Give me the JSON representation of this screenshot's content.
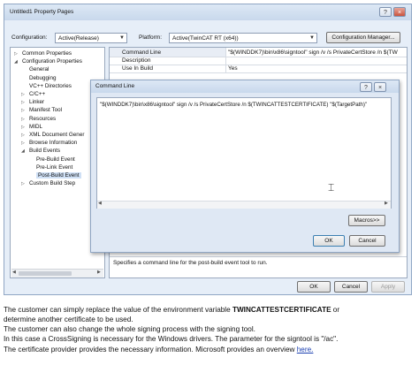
{
  "window": {
    "title": "Untitled1 Property Pages",
    "help_glyph": "?",
    "close_glyph": "×",
    "configuration_label": "Configuration:",
    "configuration_value": "Active(Release)",
    "platform_label": "Platform:",
    "platform_value": "Active(TwinCAT RT (x64))",
    "config_manager_label": "Configuration Manager...",
    "ok_label": "OK",
    "cancel_label": "Cancel",
    "apply_label": "Apply"
  },
  "tree": {
    "items": [
      {
        "label": "Common Properties",
        "expander": "▷"
      },
      {
        "label": "Configuration Properties",
        "expander": "◢"
      },
      {
        "label": "General",
        "expander": ""
      },
      {
        "label": "Debugging",
        "expander": ""
      },
      {
        "label": "VC++ Directories",
        "expander": ""
      },
      {
        "label": "C/C++",
        "expander": "▷"
      },
      {
        "label": "Linker",
        "expander": "▷"
      },
      {
        "label": "Manifest Tool",
        "expander": "▷"
      },
      {
        "label": "Resources",
        "expander": "▷"
      },
      {
        "label": "MIDL",
        "expander": "▷"
      },
      {
        "label": "XML Document Gener",
        "expander": "▷"
      },
      {
        "label": "Browse Information",
        "expander": "▷"
      },
      {
        "label": "Build Events",
        "expander": "◢"
      },
      {
        "label": "Pre-Build Event",
        "expander": ""
      },
      {
        "label": "Pre-Link Event",
        "expander": ""
      },
      {
        "label": "Post-Build Event",
        "expander": ""
      },
      {
        "label": "Custom Build Step",
        "expander": "▷"
      }
    ]
  },
  "grid": {
    "rows": [
      {
        "name": "Command Line",
        "value": "\"$(WINDDK7)\\bin\\x86\\signtool\" sign /v /s PrivateCertStore /n $(TW"
      },
      {
        "name": "Description",
        "value": ""
      },
      {
        "name": "Use In Build",
        "value": "Yes"
      }
    ],
    "description_text": "Specifies a command line for the post-build event tool to run."
  },
  "dialog": {
    "title": "Command Line",
    "help_glyph": "?",
    "close_glyph": "×",
    "command_text": "\"$(WINDDK7)\\bin\\x86\\signtool\" sign /v /s PrivateCertStore /n $(TWINCATTESTCERTIFICATE) \"$(TargetPath)\"",
    "macros_label": "Macros>>",
    "ok_label": "OK",
    "cancel_label": "Cancel"
  },
  "text": {
    "line1_a": "The customer can simply replace the value of the environment variable ",
    "line1_b": "TWINCATTESTCERTIFICATE",
    "line1_c": " or",
    "line2": "determine another certificate to be used.",
    "line3": "The customer can also change the whole signing process with the signing tool.",
    "line4": "In this case a CrossSigning is necessary for the Windows drivers. The parameter for the signtool is \"/ac\".",
    "line5_a": "The certificate provider provides the necessary information. Microsoft provides an overview ",
    "line5_link": "here."
  }
}
